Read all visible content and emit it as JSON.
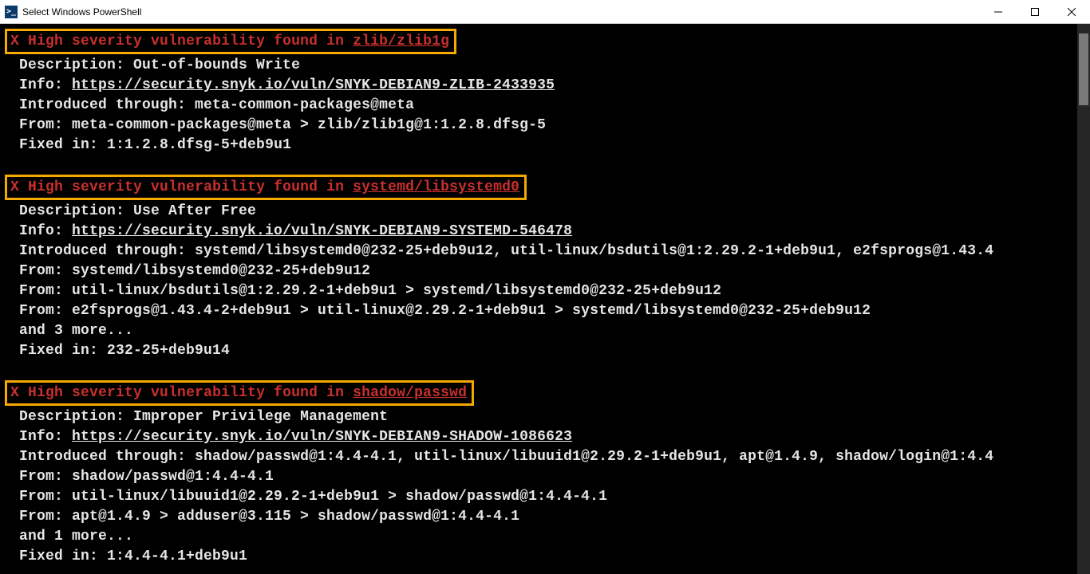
{
  "window": {
    "title": "Select Windows PowerShell",
    "icon_label": ">_"
  },
  "vulns": [
    {
      "x": "X",
      "severity": "High severity vulnerability found in ",
      "package": "zlib/zlib1g",
      "description_label": "Description: ",
      "description": "Out-of-bounds Write",
      "info_label": "Info: ",
      "info_url": "https://security.snyk.io/vuln/SNYK-DEBIAN9-ZLIB-2433935",
      "introduced_label": "Introduced through: ",
      "introduced": "meta-common-packages@meta",
      "froms": [
        "From: meta-common-packages@meta > zlib/zlib1g@1:1.2.8.dfsg-5"
      ],
      "and_more": "",
      "fixed_label": "Fixed in: ",
      "fixed": "1:1.2.8.dfsg-5+deb9u1"
    },
    {
      "x": "X",
      "severity": "High severity vulnerability found in ",
      "package": "systemd/libsystemd0",
      "description_label": "Description: ",
      "description": "Use After Free",
      "info_label": "Info: ",
      "info_url": "https://security.snyk.io/vuln/SNYK-DEBIAN9-SYSTEMD-546478",
      "introduced_label": "Introduced through: ",
      "introduced": "systemd/libsystemd0@232-25+deb9u12, util-linux/bsdutils@1:2.29.2-1+deb9u1, e2fsprogs@1.43.4",
      "froms": [
        "From: systemd/libsystemd0@232-25+deb9u12",
        "From: util-linux/bsdutils@1:2.29.2-1+deb9u1 > systemd/libsystemd0@232-25+deb9u12",
        "From: e2fsprogs@1.43.4-2+deb9u1 > util-linux@2.29.2-1+deb9u1 > systemd/libsystemd0@232-25+deb9u12"
      ],
      "and_more": "and 3 more...",
      "fixed_label": "Fixed in: ",
      "fixed": "232-25+deb9u14"
    },
    {
      "x": "X",
      "severity": "High severity vulnerability found in ",
      "package": "shadow/passwd",
      "description_label": "Description: ",
      "description": "Improper Privilege Management",
      "info_label": "Info: ",
      "info_url": "https://security.snyk.io/vuln/SNYK-DEBIAN9-SHADOW-1086623",
      "introduced_label": "Introduced through: ",
      "introduced": "shadow/passwd@1:4.4-4.1, util-linux/libuuid1@2.29.2-1+deb9u1, apt@1.4.9, shadow/login@1:4.4",
      "froms": [
        "From: shadow/passwd@1:4.4-4.1",
        "From: util-linux/libuuid1@2.29.2-1+deb9u1 > shadow/passwd@1:4.4-4.1",
        "From: apt@1.4.9 > adduser@3.115 > shadow/passwd@1:4.4-4.1"
      ],
      "and_more": "and 1 more...",
      "fixed_label": "Fixed in: ",
      "fixed": "1:4.4-4.1+deb9u1"
    }
  ]
}
